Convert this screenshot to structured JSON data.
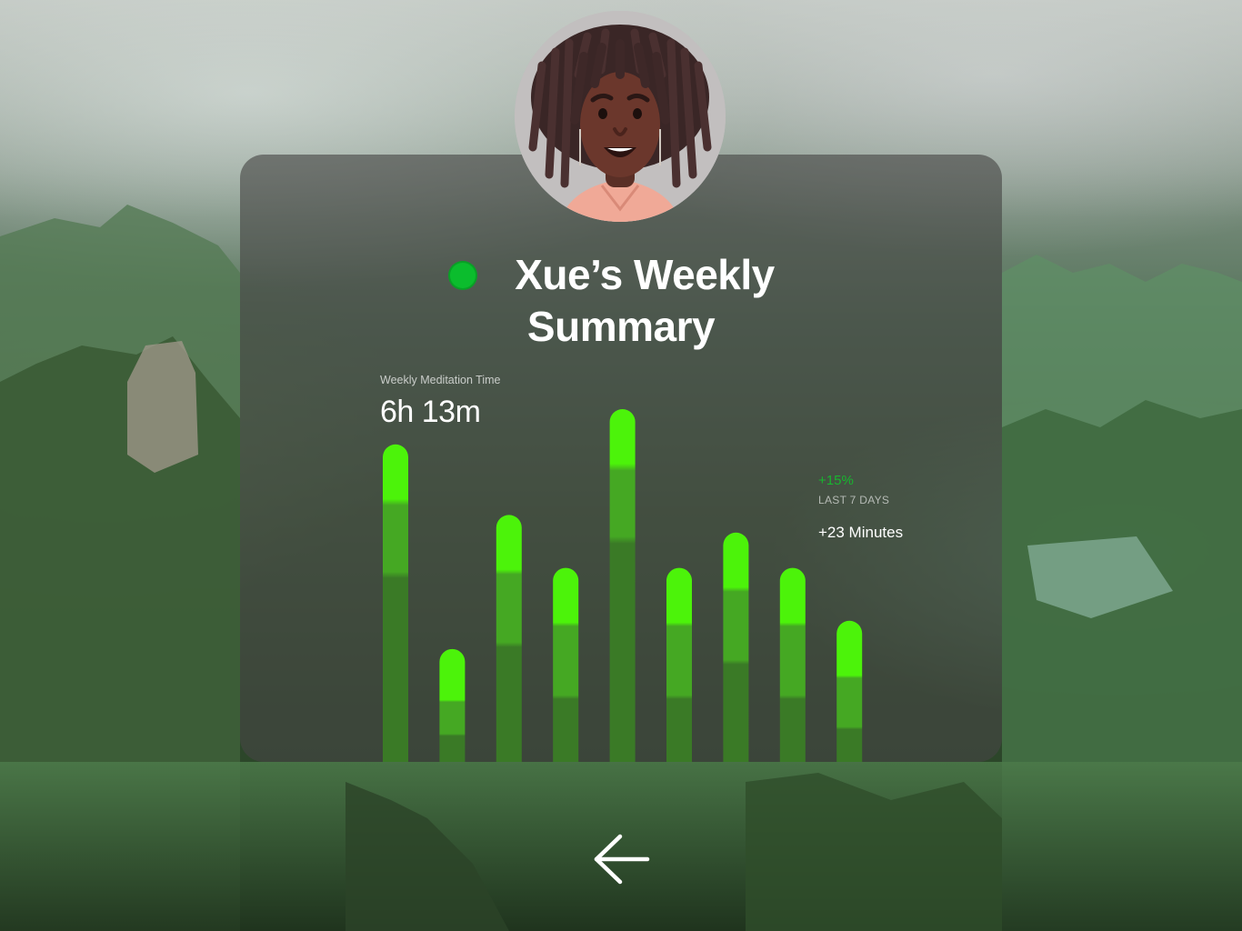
{
  "summary": {
    "title_line1": "Xue’s Weekly",
    "title_line2": "Summary",
    "status_color": "#0bbd2d"
  },
  "metric": {
    "label": "Weekly Meditation Time",
    "value": "6h 13m"
  },
  "change": {
    "percent": "+15%",
    "period": "LAST 7 DAYS",
    "minutes": "+23 Minutes"
  },
  "chart_data": {
    "type": "bar",
    "values_relative": [
      0.9,
      0.32,
      0.7,
      0.55,
      1.0,
      0.55,
      0.65,
      0.55,
      0.4
    ],
    "colors": {
      "top": "#4cf30a",
      "middle": "#45a823",
      "bottom": "#3a7a26"
    }
  },
  "icons": {
    "back": "arrow-left-icon",
    "avatar": "user-avatar",
    "status": "status-dot"
  }
}
